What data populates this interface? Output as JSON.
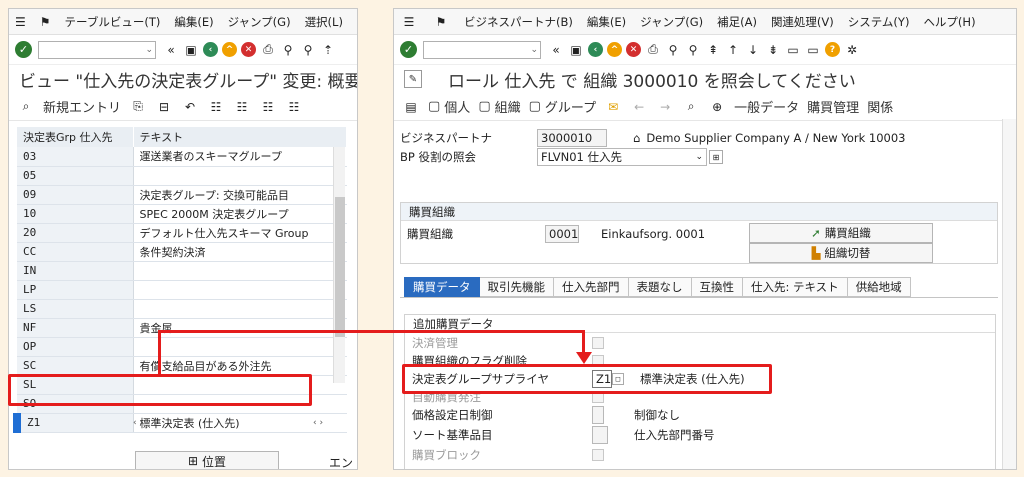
{
  "left": {
    "menu": [
      "テーブルビュー(T)",
      "編集(E)",
      "ジャンプ(G)",
      "選択(L)",
      "ユ"
    ],
    "title": "ビュー \"仕入先の決定表グループ\" 変更: 概要",
    "new_entries": "新規エントリ",
    "columns": [
      "決定表Grp 仕入先",
      "テキスト"
    ],
    "rows": [
      {
        "key": "03",
        "text": "運送業者のスキーマグループ"
      },
      {
        "key": "05",
        "text": ""
      },
      {
        "key": "09",
        "text": "決定表グループ: 交換可能品目"
      },
      {
        "key": "10",
        "text": "SPEC 2000M 決定表グループ"
      },
      {
        "key": "20",
        "text": "デフォルト仕入先スキーマ Group"
      },
      {
        "key": "CC",
        "text": "条件契約決済"
      },
      {
        "key": "IN",
        "text": ""
      },
      {
        "key": "LP",
        "text": ""
      },
      {
        "key": "LS",
        "text": ""
      },
      {
        "key": "NF",
        "text": "貴金属"
      },
      {
        "key": "OP",
        "text": ""
      },
      {
        "key": "SC",
        "text": "有償支給品目がある外注先"
      },
      {
        "key": "SL",
        "text": ""
      },
      {
        "key": "SO",
        "text": ""
      },
      {
        "key": "Z1",
        "text": "標準決定表 (仕入先)"
      }
    ],
    "position_button": "位置",
    "entry_label": "エント"
  },
  "right": {
    "menu": [
      "ビジネスパートナ(B)",
      "編集(E)",
      "ジャンプ(G)",
      "補足(A)",
      "関連処理(V)",
      "システム(Y)",
      "ヘルプ(H)"
    ],
    "title": "ロール 仕入先 で 組織 3000010 を照会してください",
    "app_toolbar": [
      "個人",
      "組織",
      "グループ",
      "一般データ",
      "購買管理",
      "関係"
    ],
    "bp_label": "ビジネスパートナ",
    "bp_value": "3000010",
    "bp_name": "Demo Supplier Company A / New York 10003",
    "role_label": "BP 役割の照会",
    "role_value": "FLVN01 仕入先",
    "purch_org_section": "購買組織",
    "purch_org_label": "購買組織",
    "purch_org_value": "0001",
    "purch_org_name": "Einkaufsorg. 0001",
    "btn_purch_org": "購買組織",
    "btn_switch_org": "組織切替",
    "tabs": [
      "購買データ",
      "取引先機能",
      "仕入先部門",
      "表題なし",
      "互換性",
      "仕入先: テキスト",
      "供給地域"
    ],
    "add_section": "追加購買データ",
    "fields": [
      {
        "label": "決済管理",
        "value": "",
        "desc": "",
        "disabled": true,
        "type": "checkbox"
      },
      {
        "label": "購買組織のフラグ削除",
        "value": "",
        "desc": "",
        "disabled": false,
        "type": "checkbox"
      },
      {
        "label": "決定表グループサプライヤ",
        "value": "Z1",
        "desc": "標準決定表 (仕入先)",
        "disabled": false,
        "type": "field"
      },
      {
        "label": "自動購買発注",
        "value": "",
        "desc": "",
        "disabled": true,
        "type": "checkbox"
      },
      {
        "label": "価格設定日制御",
        "value": "",
        "desc": "制御なし",
        "disabled": false,
        "type": "field"
      },
      {
        "label": "ソート基準品目",
        "value": "",
        "desc": "仕入先部門番号",
        "disabled": false,
        "type": "field"
      },
      {
        "label": "購買ブロック",
        "value": "",
        "desc": "",
        "disabled": true,
        "type": "checkbox"
      }
    ]
  }
}
